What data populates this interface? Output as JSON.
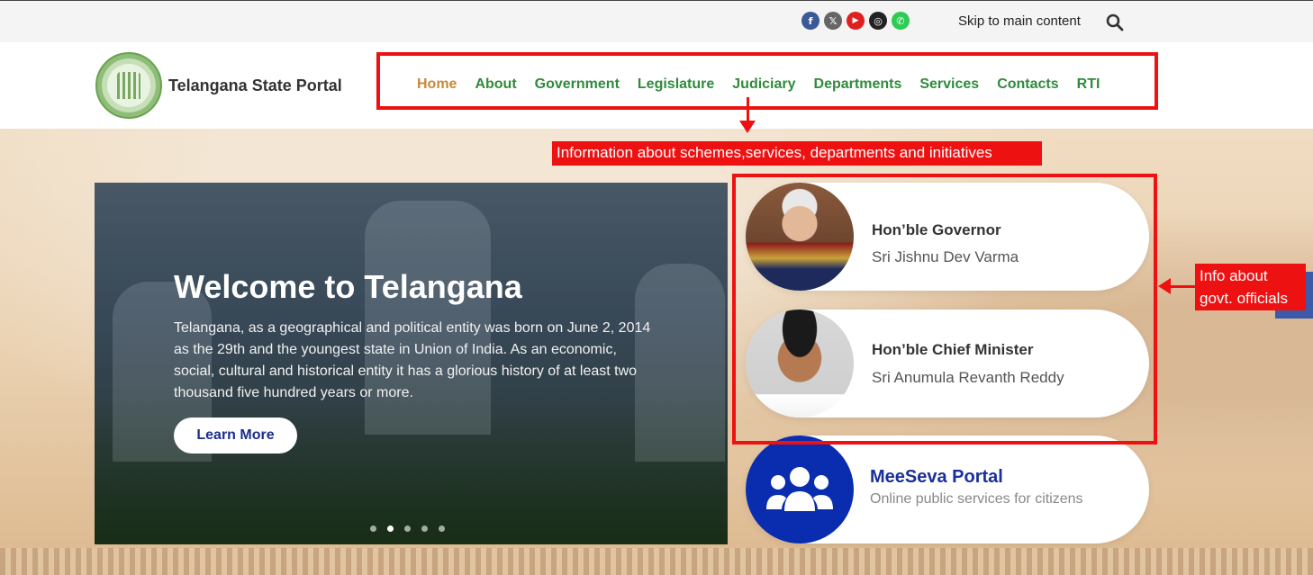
{
  "topbar": {
    "social": [
      {
        "icon": "facebook-icon",
        "glyph": "f",
        "color": "#3b5998"
      },
      {
        "icon": "x-icon",
        "glyph": "𝕏",
        "color": "#666666"
      },
      {
        "icon": "youtube-icon",
        "glyph": "▶",
        "color": "#e02020"
      },
      {
        "icon": "instagram-icon",
        "glyph": "◎",
        "color": "#222222"
      },
      {
        "icon": "whatsapp-icon",
        "glyph": "✆",
        "color": "#2ecc55"
      }
    ],
    "skip_label": "Skip to main content"
  },
  "header": {
    "site_title": "Telangana State Portal",
    "nav": [
      "Home",
      "About",
      "Government",
      "Legislature",
      "Judiciary",
      "Departments",
      "Services",
      "Contacts",
      "RTI"
    ],
    "active_nav": "Home"
  },
  "slider": {
    "title": "Welcome to Telangana",
    "text": "Telangana, as a geographical and political entity was born on June 2, 2014 as the 29th and the youngest state in Union of India. As an economic, social, cultural and historical entity it has a glorious history of at least two thousand five hundred years or more.",
    "button_label": "Learn More",
    "slide_count": 5,
    "active_slide": 2
  },
  "officials": [
    {
      "role": "Hon’ble Governor",
      "name": "Sri Jishnu Dev Varma"
    },
    {
      "role": "Hon’ble Chief Minister",
      "name": "Sri Anumula Revanth Reddy"
    }
  ],
  "meeseva": {
    "title": "MeeSeva Portal",
    "subtitle": "Online public services for citizens"
  },
  "annotations": {
    "callout_nav": "Information about schemes,services, departments and initiatives",
    "callout_officials_line1": "Info about",
    "callout_officials_line2": "govt. officials"
  },
  "colors": {
    "nav_green": "#2f8b3c",
    "nav_active": "#c58a3a",
    "annotation_red": "#ee1111",
    "meeseva_blue": "#0a2db0"
  }
}
